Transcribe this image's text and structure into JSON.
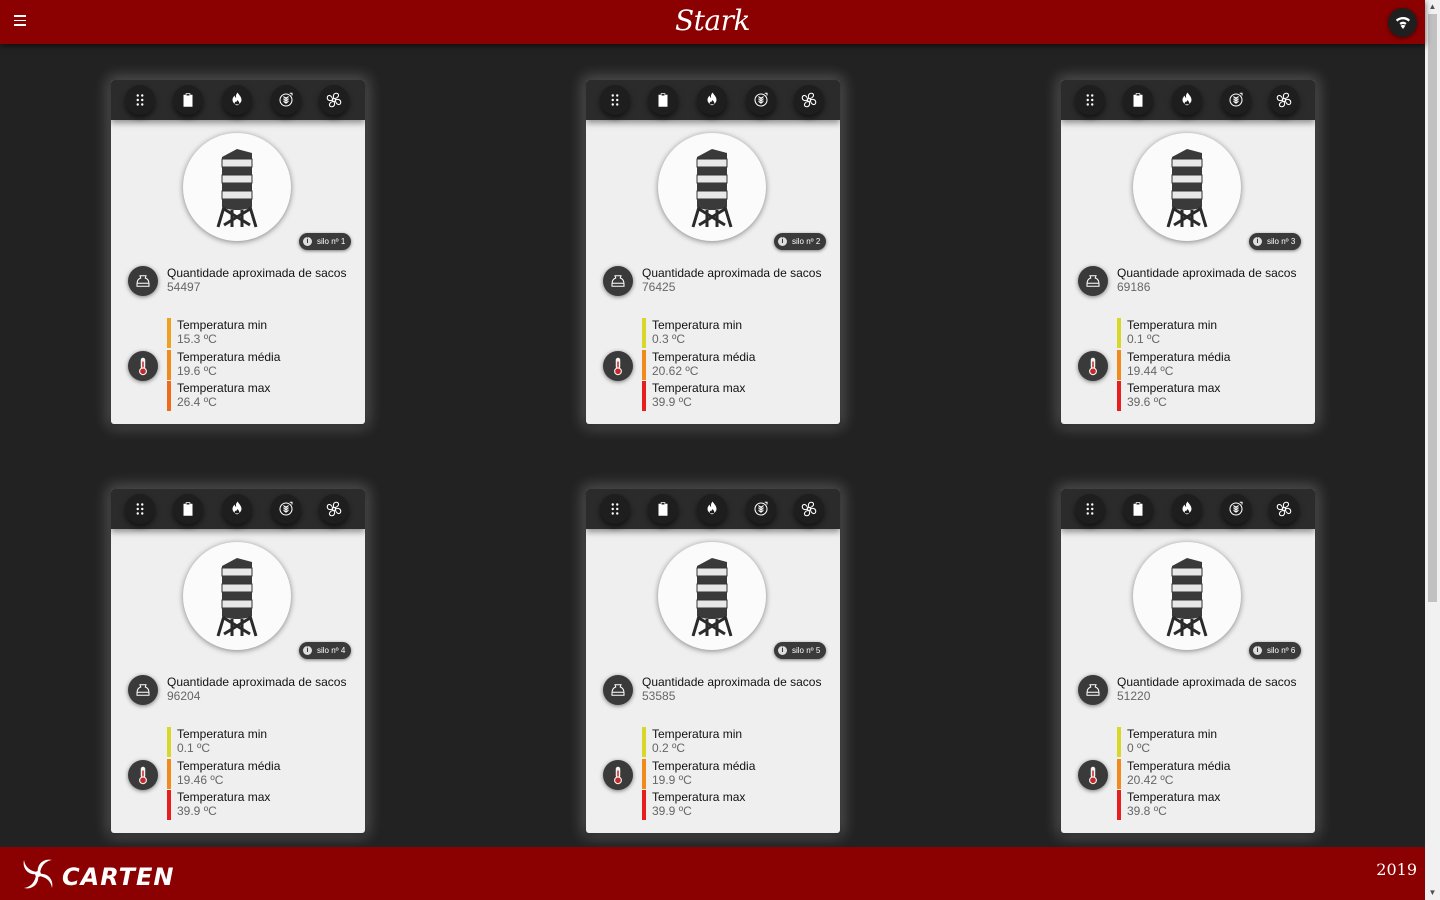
{
  "header": {
    "brand": "Stark"
  },
  "footer": {
    "brand": "CARTEN",
    "year": "2019"
  },
  "colors": {
    "bar": "#8b0000",
    "min": "#d8d82a",
    "avg": "#f08a1c",
    "max": "#e61e1e",
    "avg_hot": "#f07a1c"
  },
  "toolbar_icons": [
    "grid-icon",
    "clipboard-icon",
    "flame-icon",
    "grain-aeration-icon",
    "fan-icon"
  ],
  "labels": {
    "bags": "Quantidade aproximada de sacos",
    "temp_min": "Temperatura min",
    "temp_avg": "Temperatura média",
    "temp_max": "Temperatura max"
  },
  "silos": [
    {
      "badge": "silo nº 1",
      "bags": "54497",
      "min": "15.3 ºC",
      "avg": "19.6 ºC",
      "max": "26.4 ºC",
      "min_color": "#f0a020",
      "avg_color": "#f08a1c",
      "max_color": "#f06a1c"
    },
    {
      "badge": "silo nº 2",
      "bags": "76425",
      "min": "0.3 ºC",
      "avg": "20.62 ºC",
      "max": "39.9 ºC",
      "min_color": "#d8d82a",
      "avg_color": "#f08a1c",
      "max_color": "#e61e1e"
    },
    {
      "badge": "silo nº 3",
      "bags": "69186",
      "min": "0.1 ºC",
      "avg": "19.44 ºC",
      "max": "39.6 ºC",
      "min_color": "#d8d82a",
      "avg_color": "#f08a1c",
      "max_color": "#e61e1e"
    },
    {
      "badge": "silo nº 4",
      "bags": "96204",
      "min": "0.1 ºC",
      "avg": "19.46 ºC",
      "max": "39.9 ºC",
      "min_color": "#d8d82a",
      "avg_color": "#f08a1c",
      "max_color": "#e61e1e"
    },
    {
      "badge": "silo nº 5",
      "bags": "53585",
      "min": "0.2 ºC",
      "avg": "19.9 ºC",
      "max": "39.9 ºC",
      "min_color": "#d8d82a",
      "avg_color": "#f08a1c",
      "max_color": "#e61e1e"
    },
    {
      "badge": "silo nº 6",
      "bags": "51220",
      "min": "0 ºC",
      "avg": "20.42 ºC",
      "max": "39.8 ºC",
      "min_color": "#d8d82a",
      "avg_color": "#f08a1c",
      "max_color": "#e61e1e"
    }
  ]
}
